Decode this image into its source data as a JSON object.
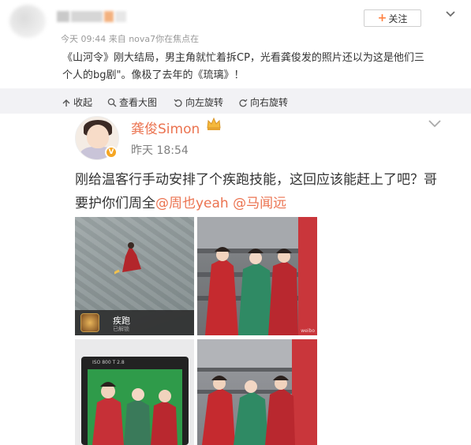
{
  "post": {
    "time": "今天 09:44",
    "source_prefix": "来自",
    "source": "nova7你在焦点在",
    "follow_label": "关注",
    "text_line1": "《山河令》刚大结局，男主角就忙着拆CP，光看龚俊发的照片还以为这是他们三",
    "text_line2": "个人的bg剧\"。像极了去年的《琉璃》！"
  },
  "toolbar": {
    "collapse": "收起",
    "view_large": "查看大图",
    "rotate_left": "向左旋转",
    "rotate_right": "向右旋转"
  },
  "embedded": {
    "author": "龚俊Simon",
    "time": "昨天 18:54",
    "text_main": "刚给温客行手动安排了个疾跑技能，这回应该能赶上了吧？哥要护你们周全",
    "mention1": "@周也yeah",
    "mention2": "@马闻远",
    "verified_mark": "V"
  },
  "photos": {
    "skill_name": "疾跑",
    "skill_sub": "已解锁",
    "monitor_text": "ISO 800  T 2.8",
    "watermark": "weibo"
  },
  "colors": {
    "accent": "#eb7350",
    "follow_plus": "#ff8140",
    "toolbar_bg": "#f2f2f5"
  }
}
